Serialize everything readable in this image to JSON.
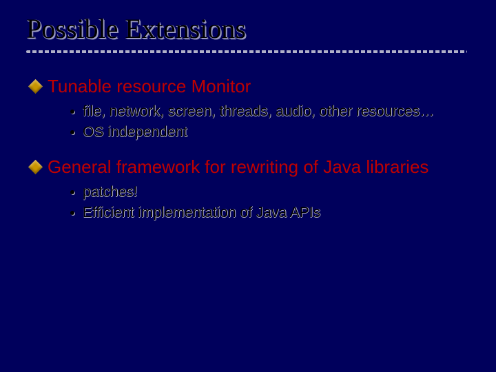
{
  "title": "Possible Extensions",
  "sections": [
    {
      "heading": "Tunable resource Monitor",
      "items": [
        "file, network, screen, threads, audio, other resources…",
        "OS independent"
      ]
    },
    {
      "heading": "General framework for rewriting of Java libraries",
      "items": [
        "patches!",
        "Efficient implementation of Java APIs"
      ]
    }
  ]
}
